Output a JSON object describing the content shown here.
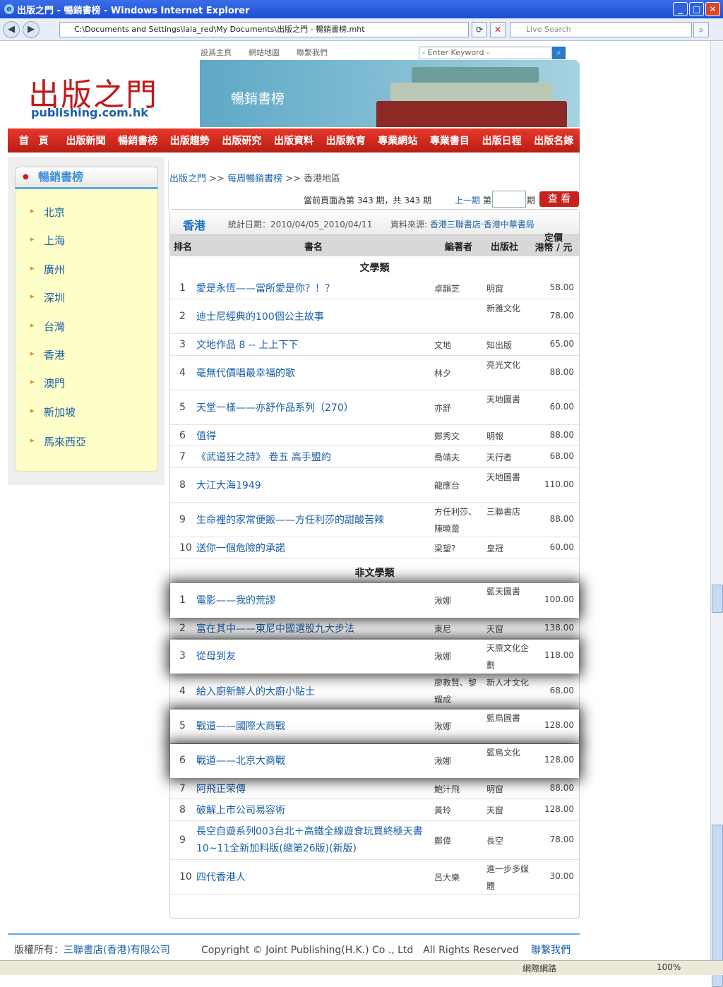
{
  "window": {
    "title": "出版之門 - 暢銷書榜 - Windows Internet Explorer",
    "address": "C:\\Documents and Settings\\lala_red\\My Documents\\出版之門 - 暢銷書榜.mht",
    "search_placeholder": "Live Search"
  },
  "top_links": [
    "設爲主頁",
    "網站地圖",
    "聯繫我們"
  ],
  "keyword_placeholder": "- Enter Keyword -",
  "logo": {
    "cn": "出版之門",
    "en": "publishing.com.hk"
  },
  "banner_title": "暢銷書榜",
  "nav": [
    "首　頁",
    "出版新聞",
    "暢銷書榜",
    "出版趨勢",
    "出版研究",
    "出版資料",
    "出版教育",
    "專業網站",
    "專業書目",
    "出版日程",
    "出版名錄"
  ],
  "sidebar": {
    "title": "暢銷書榜",
    "items": [
      "北京",
      "上海",
      "廣州",
      "深圳",
      "台灣",
      "香港",
      "澳門",
      "新加坡",
      "馬來西亞"
    ]
  },
  "breadcrumb": {
    "home": "出版之門",
    "sep1": " >> ",
    "weekly": "每周暢銷書榜",
    "sep2": " >> ",
    "current": "香港地區"
  },
  "period": {
    "text": "當前頁面為第 343 期，共 343 期",
    "prev": "上一期",
    "qi_prefix": "第",
    "qi_suffix": "期",
    "view": "查 看"
  },
  "panel": {
    "region": "香港",
    "date": "統計日期：2010/04/05_2010/04/11",
    "source_label": "資料來源:",
    "source": "香港三聯書店‧香港中華書局"
  },
  "columns": {
    "rank": "排名",
    "title": "書名",
    "author": "編著者",
    "publisher": "出版社",
    "price": "定價\n港幣 / 元"
  },
  "categories": [
    "文學類",
    "非文學類"
  ],
  "literature": [
    {
      "rank": "1",
      "title": "愛是永恆——當所愛是你？！？",
      "author": "卓韻芝",
      "publisher": "明窗",
      "price": "58.00"
    },
    {
      "rank": "2",
      "title": "迪士尼經典的100個公主故事",
      "author": "",
      "publisher": "新雅文化",
      "price": "78.00"
    },
    {
      "rank": "3",
      "title": "文地作品 8 -- 上上下下",
      "author": "文地",
      "publisher": "知出版",
      "price": "65.00"
    },
    {
      "rank": "4",
      "title": "毫無代價唱最幸福的歌",
      "author": "林夕",
      "publisher": "亮光文化",
      "price": "88.00"
    },
    {
      "rank": "5",
      "title": "天堂一樣——亦舒作品系列（270）",
      "author": "亦舒",
      "publisher": "天地圖書",
      "price": "60.00"
    },
    {
      "rank": "6",
      "title": "值得",
      "author": "鄭秀文",
      "publisher": "明報",
      "price": "88.00"
    },
    {
      "rank": "7",
      "title": "《武道狂之詩》 卷五 高手盟約",
      "author": "喬靖夫",
      "publisher": "天行者",
      "price": "68.00"
    },
    {
      "rank": "8",
      "title": "大江大海1949",
      "author": "龍應台",
      "publisher": "天地圖書",
      "price": "110.00"
    },
    {
      "rank": "9",
      "title": "生命裡的家常便飯——方任利莎的甜酸苦辣",
      "author": "方任利莎、陳曉蕾",
      "publisher": "三聯書店",
      "price": "88.00"
    },
    {
      "rank": "10",
      "title": "送你一個危險的承諾",
      "author": "梁望?",
      "publisher": "皇冠",
      "price": "60.00"
    }
  ],
  "nonliterature": [
    {
      "rank": "1",
      "title": "電影——我的荒謬",
      "author": "湫娜",
      "publisher": "藍天圖書",
      "price": "100.00"
    },
    {
      "rank": "2",
      "title": "富在其中——東尼中國選股九大步法",
      "author": "東尼",
      "publisher": "天窗",
      "price": "138.00"
    },
    {
      "rank": "3",
      "title": "從母到友",
      "author": "湫娜",
      "publisher": "天原文化企劃",
      "price": "118.00"
    },
    {
      "rank": "4",
      "title": "給入廚新鮮人的大廚小貼士",
      "author": "廖教賢、黎耀成",
      "publisher": "新人才文化",
      "price": "68.00"
    },
    {
      "rank": "5",
      "title": "戰道——國際大商戰",
      "author": "湫娜",
      "publisher": "藍鳥圖書",
      "price": "128.00"
    },
    {
      "rank": "6",
      "title": "戰道——北京大商戰",
      "author": "湫娜",
      "publisher": "藍鳥文化",
      "price": "128.00"
    },
    {
      "rank": "7",
      "title": "阿飛正荣傳",
      "author": "鮑汁飛",
      "publisher": "明窗",
      "price": "88.00"
    },
    {
      "rank": "8",
      "title": "破解上市公司易容術",
      "author": "黃玲",
      "publisher": "天窗",
      "price": "128.00"
    },
    {
      "rank": "9",
      "title": "長空自遊系列003台北＋高鐵全線遊食玩買終極天書10~11全新加料版(總第26版)(新版)",
      "author": "鄭偉",
      "publisher": "長空",
      "price": "78.00"
    },
    {
      "rank": "10",
      "title": "四代香港人",
      "author": "呂大樂",
      "publisher": "進一步多媒體",
      "price": "30.00"
    }
  ],
  "footer": {
    "owner_label": "版權所有：",
    "owner": "三聯書店(香港)有限公司",
    "copyright": "Copyright © Joint Publishing(H.K.) Co ., Ltd　All Rights Reserved",
    "contact": "聯繫我們"
  },
  "status": {
    "zone": "網際網路",
    "zoom": "100%"
  }
}
